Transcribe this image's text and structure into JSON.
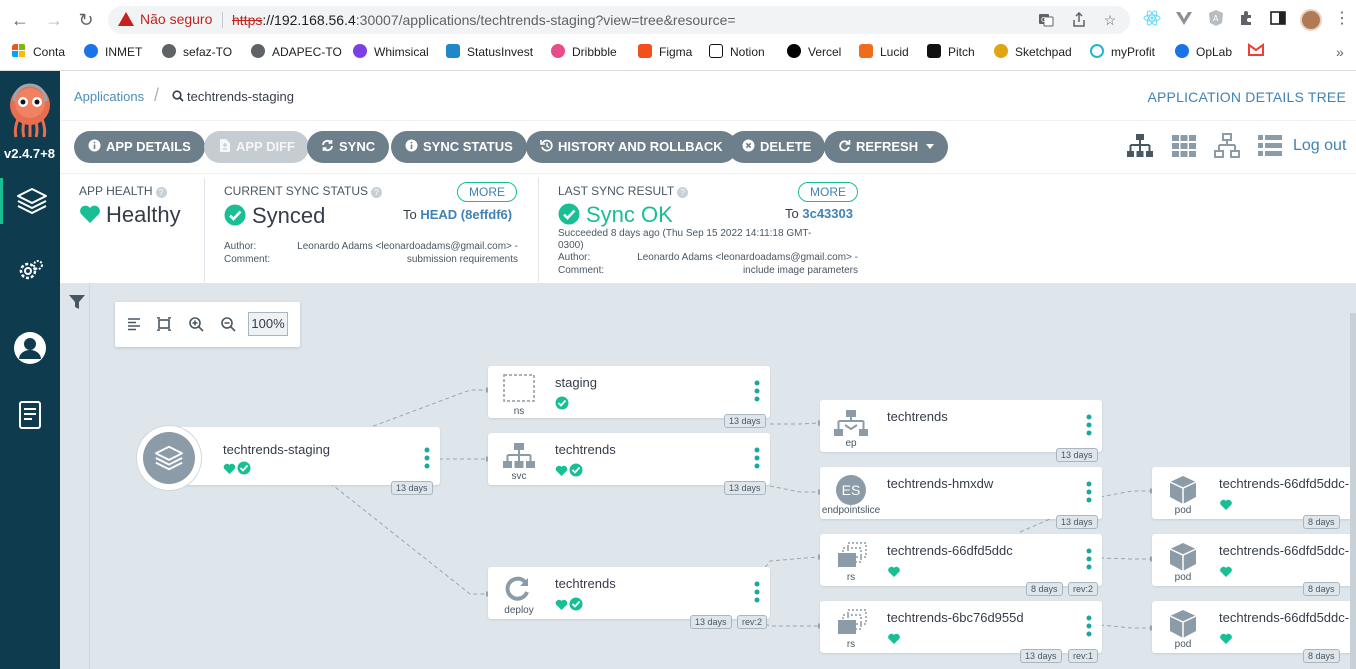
{
  "browser": {
    "security_label": "Não seguro",
    "url_https": "https",
    "url_host": "://192.168.56.4",
    "url_rest": ":30007/applications/techtrends-staging?view=tree&resource=",
    "bookmarks": [
      {
        "label": "Conta",
        "color": "#f25022"
      },
      {
        "label": "INMET",
        "color": "#1a73e8"
      },
      {
        "label": "sefaz-TO",
        "color": "#5f6368"
      },
      {
        "label": "ADAPEC-TO",
        "color": "#5f6368"
      },
      {
        "label": "Whimsical",
        "color": "#7b3fe4"
      },
      {
        "label": "StatusInvest",
        "color": "#1f88c9"
      },
      {
        "label": "Dribbble",
        "color": "#ea4c89"
      },
      {
        "label": "Figma",
        "color": "#f24e1e"
      },
      {
        "label": "Notion",
        "color": "#111111"
      },
      {
        "label": "Vercel",
        "color": "#000000"
      },
      {
        "label": "Lucid",
        "color": "#f26b1d"
      },
      {
        "label": "Pitch",
        "color": "#111111"
      },
      {
        "label": "Sketchpad",
        "color": "#e0a512"
      },
      {
        "label": "myProfit",
        "color": "#21b5d1"
      },
      {
        "label": "OpLab",
        "color": "#1a73e8"
      }
    ]
  },
  "sidebar": {
    "version": "v2.4.7+8"
  },
  "topbar": {
    "breadcrumb_root": "Applications",
    "breadcrumb_current": "techtrends-staging",
    "page_title": "APPLICATION DETAILS TREE"
  },
  "toolbar": {
    "app_details": "APP DETAILS",
    "app_diff": "APP DIFF",
    "sync": "SYNC",
    "sync_status": "SYNC STATUS",
    "history": "HISTORY AND ROLLBACK",
    "delete": "DELETE",
    "refresh": "REFRESH",
    "logout": "Log out"
  },
  "status": {
    "health": {
      "label": "APP HEALTH",
      "value": "Healthy"
    },
    "sync": {
      "label": "CURRENT SYNC STATUS",
      "value": "Synced",
      "more": "MORE",
      "to_prefix": "To",
      "to_ref": "HEAD (8effdf6)",
      "author_label": "Author:",
      "author": "Leonardo Adams <leonardoadams@gmail.com> -",
      "comment_label": "Comment:",
      "comment": "submission requirements"
    },
    "last_sync": {
      "label": "LAST SYNC RESULT",
      "value": "Sync OK",
      "more": "MORE",
      "to_prefix": "To",
      "to_ref": "3c43303",
      "succeeded_1": "Succeeded 8 days ago (Thu Sep 15 2022 14:11:18 GMT-",
      "succeeded_2": "0300)",
      "author_label": "Author:",
      "author": "Leonardo Adams <leonardoadams@gmail.com> -",
      "comment_label": "Comment:",
      "comment": "include image parameters"
    }
  },
  "canvas": {
    "zoom": "100%",
    "root": {
      "name": "techtrends-staging",
      "age": "13 days"
    },
    "nodes": {
      "ns": {
        "name": "staging",
        "kind": "ns",
        "age": "13 days"
      },
      "svc": {
        "name": "techtrends",
        "kind": "svc",
        "age": "13 days"
      },
      "deploy": {
        "name": "techtrends",
        "kind": "deploy",
        "age": "13 days",
        "rev": "rev:2"
      },
      "ep": {
        "name": "techtrends",
        "kind": "ep",
        "age": "13 days"
      },
      "eps": {
        "name": "techtrends-hmxdw",
        "kind": "endpointslice",
        "badge": "ES",
        "age": "13 days"
      },
      "rs1": {
        "name": "techtrends-66dfd5ddc",
        "kind": "rs",
        "age": "8 days",
        "rev": "rev:2"
      },
      "rs2": {
        "name": "techtrends-6bc76d955d",
        "kind": "rs",
        "age": "13 days",
        "rev": "rev:1"
      },
      "pod1": {
        "name": "techtrends-66dfd5ddc-",
        "kind": "pod",
        "age": "8 days"
      },
      "pod2": {
        "name": "techtrends-66dfd5ddc-",
        "kind": "pod",
        "age": "8 days"
      },
      "pod3": {
        "name": "techtrends-66dfd5ddc-",
        "kind": "pod",
        "age": "8 days"
      }
    }
  },
  "colors": {
    "healthy": "#18be94",
    "accent_blue": "#3f83b4",
    "button_grey": "#6d7f8b",
    "sidebar": "#0f3b4f",
    "security_red": "#c5221f"
  }
}
